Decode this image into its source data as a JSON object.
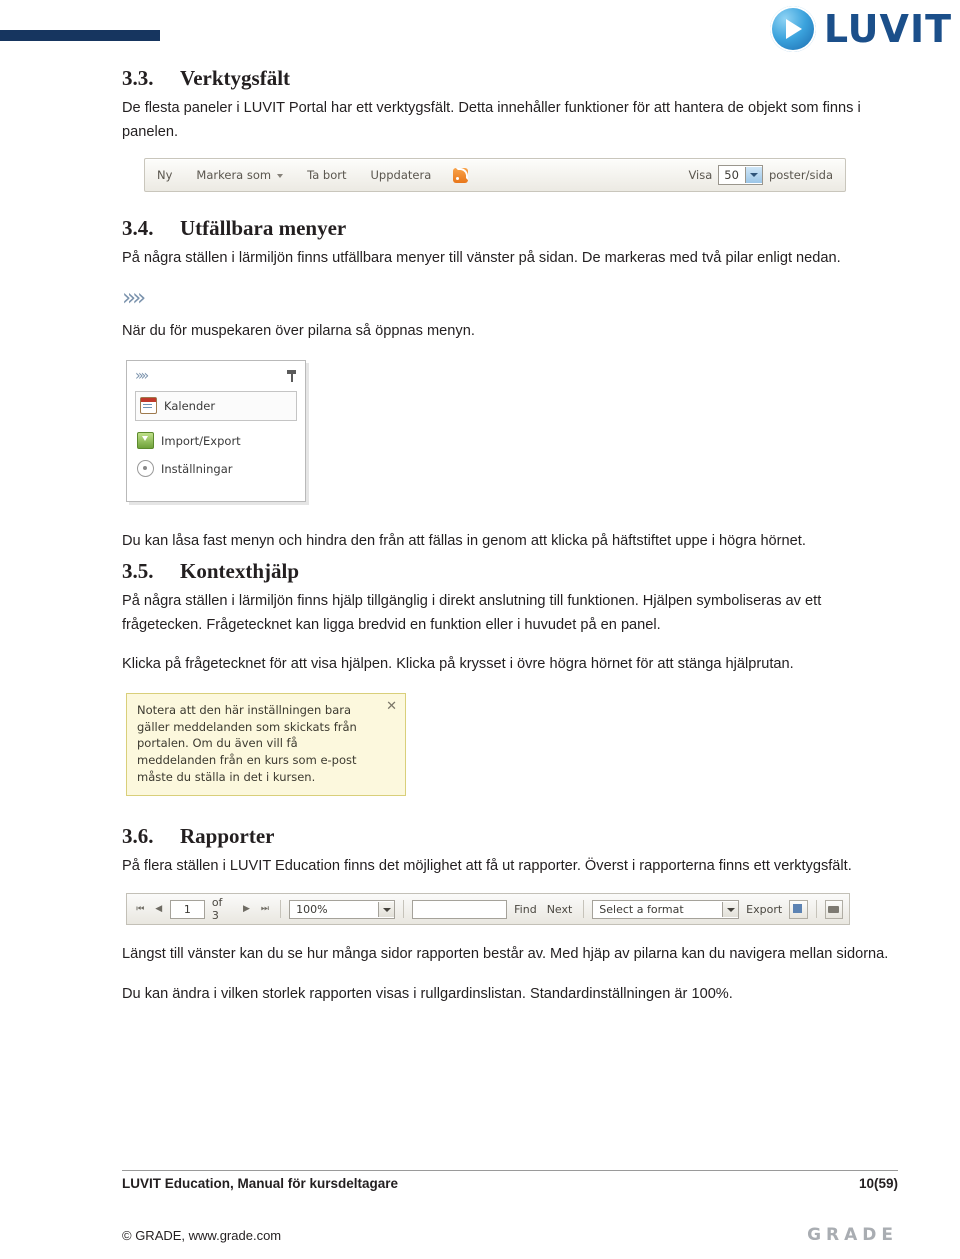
{
  "header": {
    "logo_text": "LUVIT",
    "logo_mark_name": "luvit-globe-logo"
  },
  "sections": [
    {
      "number": "3.3.",
      "title": "Verktygsfält",
      "paragraphs": [
        "De flesta paneler i LUVIT Portal har ett verktygsfält. Detta innehåller funktioner för att hantera de objekt som finns i panelen."
      ]
    },
    {
      "number": "3.4.",
      "title": "Utfällbara menyer",
      "paragraphs": [
        "På några ställen i lärmiljön finns utfällbara menyer till vänster på sidan. De markeras med två pilar enligt nedan.",
        "När du för muspekaren över pilarna så öppnas menyn.",
        "Du kan låsa fast menyn och hindra den från att fällas in genom att klicka på häftstiftet uppe i högra hörnet."
      ]
    },
    {
      "number": "3.5.",
      "title": "Kontexthjälp",
      "paragraphs": [
        "På några ställen i lärmiljön finns hjälp tillgänglig i direkt anslutning till funktionen. Hjälpen symboliseras av ett frågetecken. Frågetecknet kan ligga bredvid en funktion eller i huvudet på en panel.",
        "Klicka på frågetecknet för att visa hjälpen. Klicka på krysset i övre högra hörnet för att stänga hjälprutan."
      ]
    },
    {
      "number": "3.6.",
      "title": "Rapporter",
      "paragraphs": [
        "På flera ställen i LUVIT Education finns det möjlighet att få ut rapporter. Överst i rapporterna finns ett verktygsfält.",
        "Längst till vänster kan du se hur många sidor rapporten består av. Med hjäp av pilarna kan du navigera mellan sidorna.",
        "Du kan ändra i vilken storlek rapporten visas i rullgardinslistan. Standardinställningen är 100%."
      ]
    }
  ],
  "toolbar_shot": {
    "items": [
      "Ny",
      "Markera som",
      "Ta bort",
      "Uppdatera"
    ],
    "rss_icon": "rss-feed-icon",
    "visa_label": "Visa",
    "page_size": "50",
    "per_page_label": "poster/sida"
  },
  "flyout_menu": {
    "chevron_icon": "double-chevron-right-icon",
    "pin_icon": "pushpin-icon",
    "items": [
      {
        "label": "Kalender",
        "icon": "calendar-icon"
      },
      {
        "label": "Import/Export",
        "icon": "import-export-icon"
      },
      {
        "label": "Inställningar",
        "icon": "settings-gear-icon"
      }
    ]
  },
  "help_popup": {
    "close_icon": "close-x-icon",
    "text": "Notera att den här inställningen bara gäller meddelanden som skickats från portalen. Om du även vill få meddelanden från en kurs som e-post måste du ställa in det i kursen."
  },
  "report_toolbar": {
    "first_page_icon": "first-page-icon",
    "prev_page_icon": "previous-page-icon",
    "page_value": "1",
    "of_label": "of 3",
    "next_page_icon": "next-page-icon",
    "last_page_icon": "last-page-icon",
    "zoom_value": "100%",
    "find_label": "Find",
    "next_label": "Next",
    "format_value": "Select a format",
    "export_label": "Export",
    "save_icon": "save-disk-icon",
    "print_icon": "printer-icon"
  },
  "footer": {
    "left": "LUVIT Education, Manual för kursdeltagare",
    "right": "10(59)",
    "copyright": "© GRADE, www.grade.com",
    "brand": "GRADE"
  }
}
